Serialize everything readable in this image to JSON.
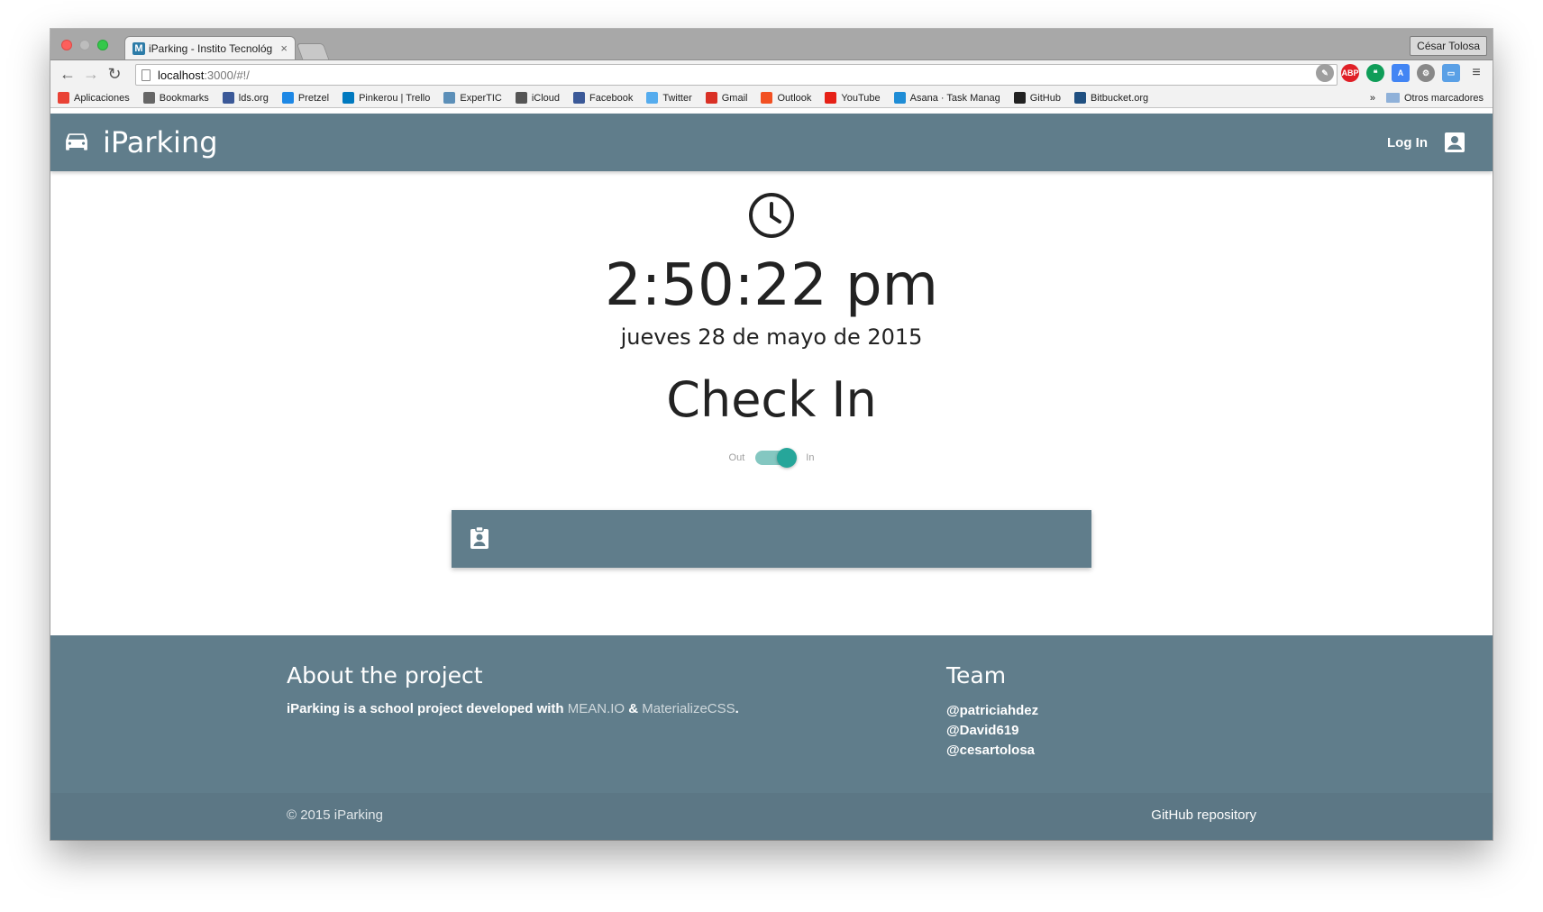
{
  "browser": {
    "tab_title": "iParking - Instito Tecnológ",
    "tab_favicon": "M",
    "profile_name": "César Tolosa",
    "url_host": "localhost",
    "url_rest": ":3000/#!/",
    "bookmarks": [
      {
        "label": "Aplicaciones",
        "icon": "apps-grid-icon",
        "color": "#e94235"
      },
      {
        "label": "Bookmarks",
        "icon": "star-icon",
        "color": "#666666"
      },
      {
        "label": "lds.org",
        "icon": "lds-icon",
        "color": "#3b5998"
      },
      {
        "label": "Pretzel",
        "icon": "pretzel-icon",
        "color": "#1e88e5"
      },
      {
        "label": "Pinkerou | Trello",
        "icon": "trello-icon",
        "color": "#0079bf"
      },
      {
        "label": "ExperTIC",
        "icon": "globe-icon",
        "color": "#5c8fb8"
      },
      {
        "label": "iCloud",
        "icon": "apple-icon",
        "color": "#555555"
      },
      {
        "label": "Facebook",
        "icon": "facebook-icon",
        "color": "#3b5998"
      },
      {
        "label": "Twitter",
        "icon": "twitter-icon",
        "color": "#55acee"
      },
      {
        "label": "Gmail",
        "icon": "gmail-icon",
        "color": "#d93025"
      },
      {
        "label": "Outlook",
        "icon": "windows-icon",
        "color": "#f25022"
      },
      {
        "label": "YouTube",
        "icon": "youtube-icon",
        "color": "#e62117"
      },
      {
        "label": "Asana · Task Manag",
        "icon": "asana-icon",
        "color": "#1f8dd6"
      },
      {
        "label": "GitHub",
        "icon": "github-icon",
        "color": "#222222"
      },
      {
        "label": "Bitbucket.org",
        "icon": "bitbucket-icon",
        "color": "#205081"
      }
    ],
    "bookmarks_overflow": "»",
    "other_bookmarks": "Otros marcadores"
  },
  "app": {
    "brand": "iParking",
    "login_label": "Log In",
    "time": "2:50:22 pm",
    "date": "jueves 28 de mayo de 2015",
    "status_title": "Check In",
    "switch_off_label": "Out",
    "switch_on_label": "In",
    "switch_checked": true,
    "colors": {
      "primary": "#607d8b",
      "accent": "#26a69a"
    }
  },
  "footer": {
    "about_title": "About the project",
    "about_text": "iParking is a school project developed with ",
    "about_link1": "MEAN.IO",
    "about_amp": " & ",
    "about_link2": "MaterializeCSS",
    "about_end": ".",
    "team_title": "Team",
    "team": [
      "@patriciahdez",
      "@David619",
      "@cesartolosa"
    ],
    "copyright": "© 2015 iParking",
    "repo_link": "GitHub repository"
  }
}
